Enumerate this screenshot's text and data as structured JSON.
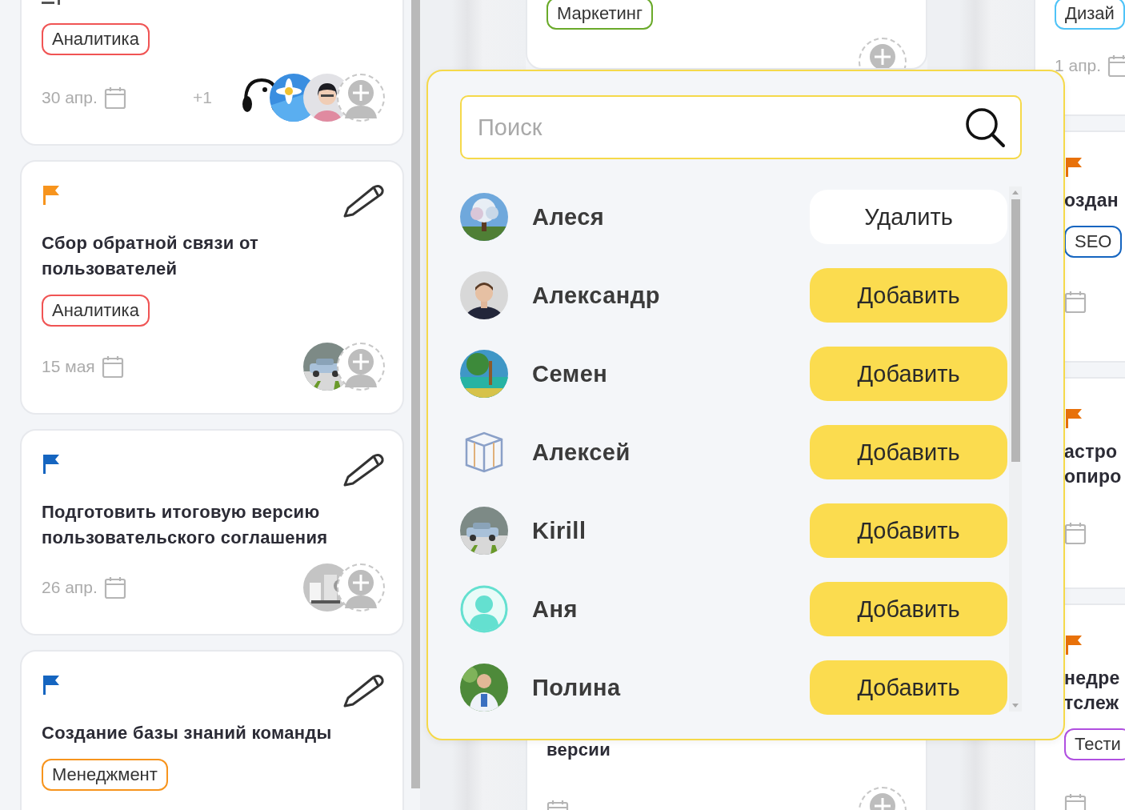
{
  "board": {
    "columns": [
      {
        "cards": [
          {
            "has_description": true,
            "editable": false,
            "tag": {
              "label": "Аналитика",
              "color": "#f05454"
            },
            "date": "30 апр.",
            "calendar": true,
            "extra_count": "+1",
            "assignees": [
              {
                "kind": "picture"
              },
              {
                "kind": "picture"
              },
              {
                "kind": "picture"
              },
              {
                "kind": "add"
              }
            ]
          },
          {
            "has_description": false,
            "editable": true,
            "flag": {
              "color": "#f7941d"
            },
            "title": "Сбор обратной связи от пользователей",
            "tag": {
              "label": "Аналитика",
              "color": "#f05454"
            },
            "date": "15 мая",
            "calendar": true,
            "assignees": [
              {
                "kind": "picture"
              },
              {
                "kind": "add"
              }
            ]
          },
          {
            "has_description": false,
            "editable": true,
            "flag": {
              "color": "#1565c0"
            },
            "title": "Подготовить итоговую версию пользовательского соглашения",
            "date": "26 апр.",
            "calendar": true,
            "assignees": [
              {
                "kind": "picture"
              },
              {
                "kind": "add"
              }
            ]
          },
          {
            "has_description": false,
            "editable": true,
            "flag": {
              "color": "#1565c0"
            },
            "title": "Создание базы знаний команды",
            "tag": {
              "label": "Менеджмент",
              "color": "#f7941d"
            },
            "calendar": false
          }
        ]
      },
      {
        "cards": [
          {
            "has_description": false,
            "editable": false,
            "tag": {
              "label": "Маркетинг",
              "color": "#6aaa2a"
            },
            "calendar": false,
            "assignees": [
              {
                "kind": "add"
              }
            ]
          },
          {
            "has_description": false,
            "editable": false,
            "title": "версии",
            "calendar": true,
            "assignees": [
              {
                "kind": "add"
              }
            ]
          }
        ]
      },
      {
        "cards": [
          {
            "has_description": false,
            "editable": false,
            "tag": {
              "label": "Дизай",
              "color": "#4fc3f7"
            },
            "date": "1 апр.",
            "calendar": true
          },
          {
            "has_description": false,
            "editable": false,
            "flag": {
              "color": "#e8710a"
            },
            "title": "оздан",
            "tag": {
              "label": "SEO",
              "color": "#1565c0"
            },
            "calendar": true
          },
          {
            "has_description": false,
            "editable": false,
            "flag": {
              "color": "#e8710a"
            },
            "title": "астро опиро",
            "calendar": true
          },
          {
            "has_description": false,
            "editable": false,
            "flag": {
              "color": "#e8710a"
            },
            "title": "недре тслеж",
            "tag": {
              "label": "Тести",
              "color": "#b04fe0"
            },
            "calendar": true
          }
        ]
      }
    ]
  },
  "assignee_popup": {
    "search": {
      "placeholder": "Поиск"
    },
    "members": [
      {
        "name": "Алеся",
        "kind": "picture",
        "assigned": true,
        "action": "Удалить"
      },
      {
        "name": "Александр",
        "kind": "picture",
        "assigned": false,
        "action": "Добавить"
      },
      {
        "name": "Семен",
        "kind": "picture",
        "assigned": false,
        "action": "Добавить"
      },
      {
        "name": "Алексей",
        "kind": "cube",
        "assigned": false,
        "action": "Добавить"
      },
      {
        "name": "Kirill",
        "kind": "picture",
        "assigned": false,
        "action": "Добавить"
      },
      {
        "name": "Аня",
        "kind": "silhouette",
        "assigned": false,
        "action": "Добавить"
      },
      {
        "name": "Полина",
        "kind": "picture",
        "assigned": false,
        "action": "Добавить"
      }
    ]
  }
}
